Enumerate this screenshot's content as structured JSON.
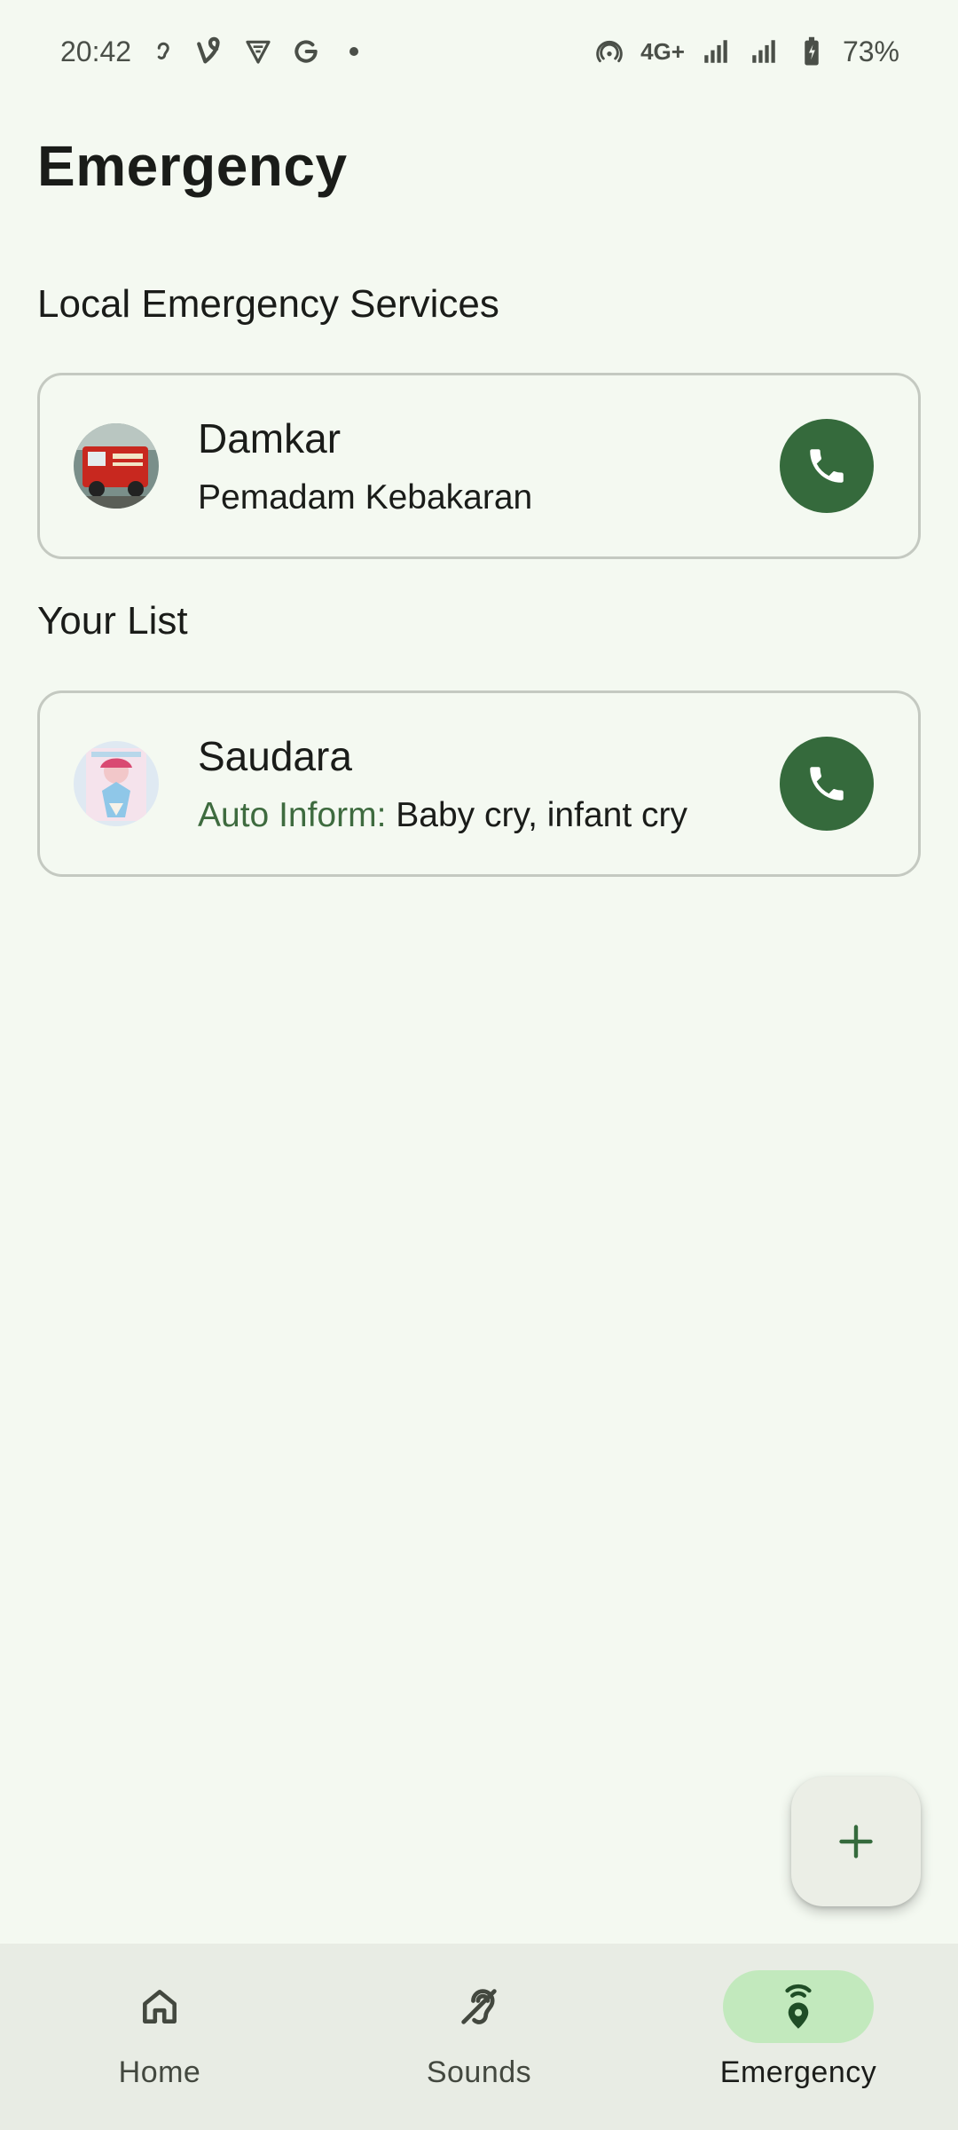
{
  "status_bar": {
    "time": "20:42",
    "left_icons": [
      "hearing-icon",
      "vine-icon",
      "vpn-shield-icon",
      "google-icon"
    ],
    "network": "4G+",
    "battery": "73%"
  },
  "page": {
    "title": "Emergency"
  },
  "sections": {
    "local_title": "Local Emergency Services",
    "list_title": "Your List"
  },
  "local_services": [
    {
      "name": "Damkar",
      "subtitle": "Pemadam Kebakaran",
      "avatar": "fire-truck-photo",
      "action_icon": "phone-icon"
    }
  ],
  "your_list": [
    {
      "name": "Saudara",
      "auto_inform_label": "Auto Inform:",
      "auto_inform_value": " Baby cry, infant cry",
      "avatar": "illustration-photo",
      "action_icon": "phone-icon"
    }
  ],
  "fab": {
    "icon": "plus-icon"
  },
  "bottom_nav": [
    {
      "label": "Home",
      "icon": "home-icon",
      "active": false
    },
    {
      "label": "Sounds",
      "icon": "hearing-sound-icon",
      "active": false
    },
    {
      "label": "Emergency",
      "icon": "location-broadcast-icon",
      "active": true
    }
  ],
  "colors": {
    "background": "#f4f9f1",
    "accent": "#356a3c",
    "active_pill": "#c2e9bd",
    "auto_inform": "#3e6b3f"
  }
}
